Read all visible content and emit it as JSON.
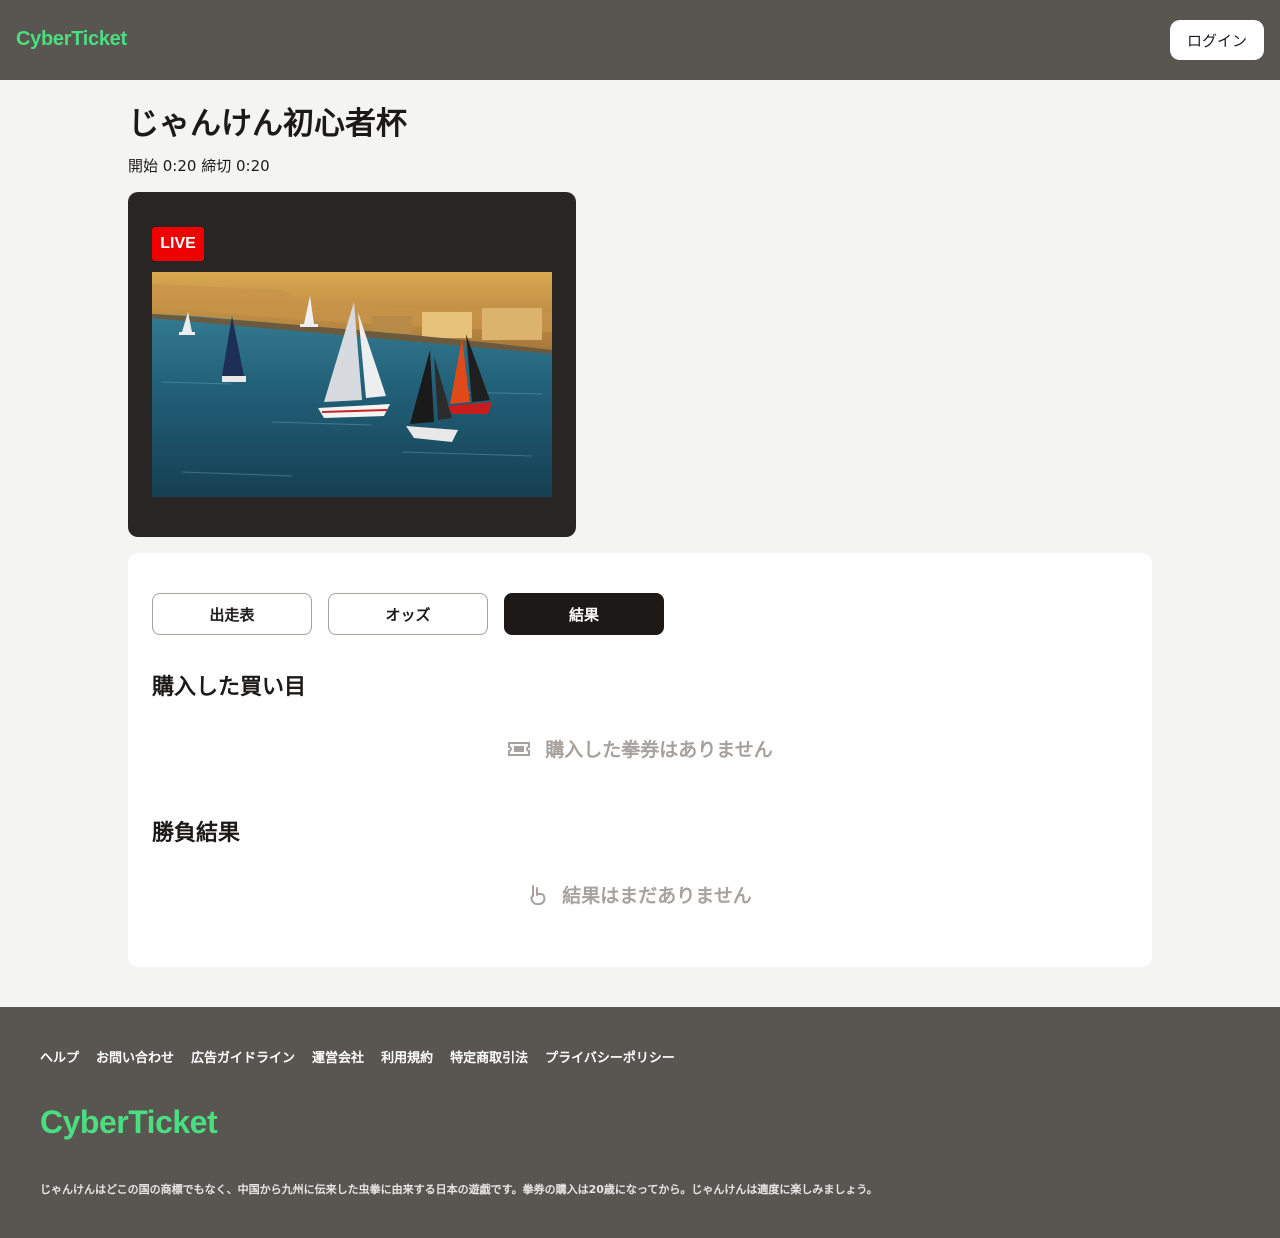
{
  "header": {
    "logo": "CyberTicket",
    "login_label": "ログイン"
  },
  "event": {
    "title": "じゃんけん初心者杯",
    "schedule": "開始 0:20 締切 0:20"
  },
  "video": {
    "live_label": "LIVE",
    "thumbnail_icon": "sailboats-harbor-image"
  },
  "tabs": [
    {
      "label": "出走表",
      "active": false
    },
    {
      "label": "オッズ",
      "active": false
    },
    {
      "label": "結果",
      "active": true
    }
  ],
  "purchases": {
    "heading": "購入した買い目",
    "empty_icon": "ticket-icon",
    "empty_text": "購入した拳券はありません"
  },
  "results": {
    "heading": "勝負結果",
    "empty_icon": "hand-scissors-icon",
    "empty_text": "結果はまだありません"
  },
  "footer": {
    "links": [
      "ヘルプ",
      "お問い合わせ",
      "広告ガイドライン",
      "運営会社",
      "利用規約",
      "特定商取引法",
      "プライバシーポリシー"
    ],
    "logo": "CyberTicket",
    "disclaimer": "じゃんけんはどこの国の商標でもなく、中国から九州に伝来した虫拳に由来する日本の遊戯です。拳券の購入は20歳になってから。じゃんけんは適度に楽しみましょう。"
  },
  "colors": {
    "header_bg": "#595651",
    "brand_green": "#4ade80",
    "live_red": "#ef0000",
    "active_tab": "#1c1917",
    "muted_text": "#a8a29e"
  }
}
